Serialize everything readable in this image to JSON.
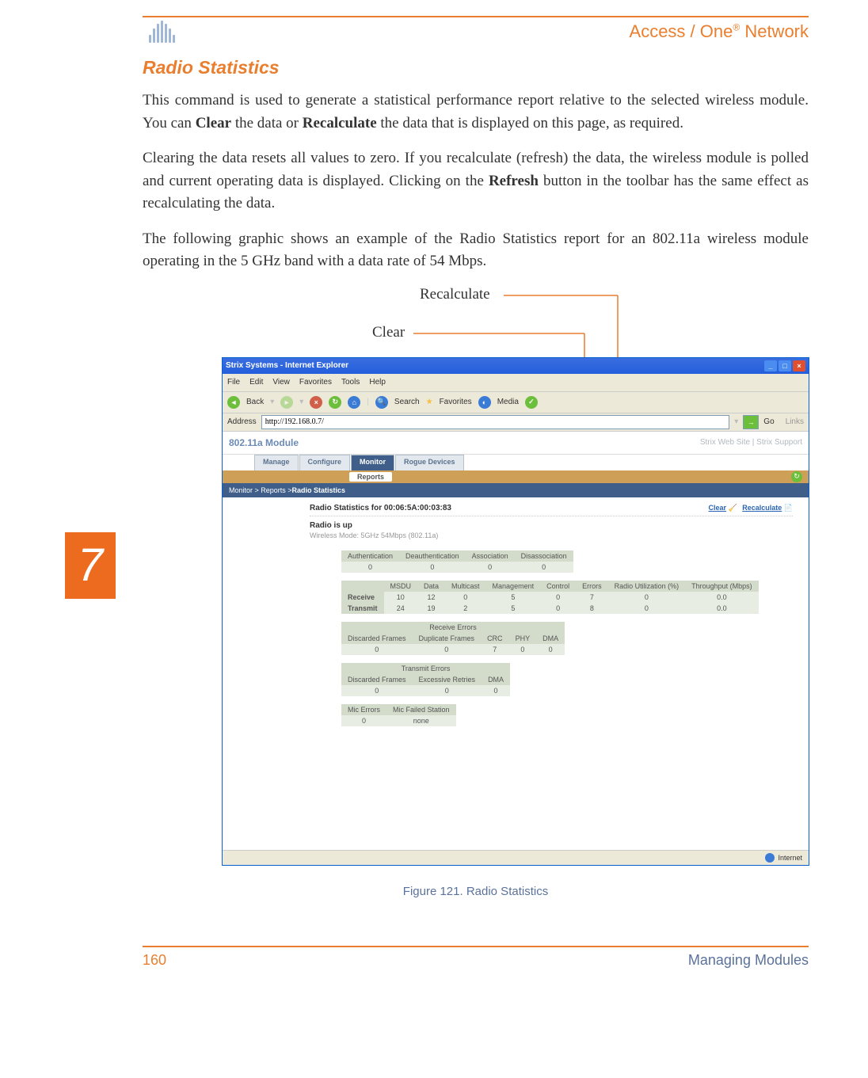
{
  "header": {
    "brand_html": "Access / One® Network"
  },
  "title": "Radio Statistics",
  "chapter_number": "7",
  "paragraphs": {
    "p1_pre": "This command is used to generate a statistical performance report relative to the selected wireless module. You can ",
    "p1_b1": "Clear",
    "p1_mid": " the data or ",
    "p1_b2": "Recalculate",
    "p1_post": " the data that is displayed on this page, as required.",
    "p2_pre": "Clearing the data resets all values to zero. If you recalculate (refresh) the data, the wireless module is polled and current operating data is displayed. Clicking on the ",
    "p2_b1": "Refresh",
    "p2_post": " button in the toolbar has the same effect as recalculating the data.",
    "p3": "The following graphic shows an example of the Radio Statistics report for an 802.11a wireless module operating in the 5 GHz band with a data rate of 54 Mbps."
  },
  "callouts": {
    "recalculate": "Recalculate",
    "clear": "Clear"
  },
  "screenshot": {
    "window_title": "Strix Systems - Internet Explorer",
    "menus": [
      "File",
      "Edit",
      "View",
      "Favorites",
      "Tools",
      "Help"
    ],
    "toolbar": {
      "back": "Back",
      "search": "Search",
      "favorites": "Favorites",
      "media": "Media"
    },
    "address_label": "Address",
    "address_value": "http://192.168.0.7/",
    "go": "Go",
    "links": "Links",
    "module_name": "802.11a Module",
    "site_links": "Strix Web Site  |  Strix Support",
    "tabs": [
      "Manage",
      "Configure",
      "Monitor",
      "Rogue Devices"
    ],
    "subtab": "Reports",
    "breadcrumb_pre": "Monitor > Reports > ",
    "breadcrumb_cur": "Radio Statistics",
    "stats_title": "Radio Statistics for 00:06:5A:00:03:83",
    "actions": {
      "clear": "Clear",
      "recalculate": "Recalculate"
    },
    "radio_status": "Radio is  up",
    "wireless_mode": "Wireless Mode: 5GHz 54Mbps (802.11a)",
    "table1": {
      "headers": [
        "Authentication",
        "Deauthentication",
        "Association",
        "Disassociation"
      ],
      "row": [
        "0",
        "0",
        "0",
        "0"
      ]
    },
    "table2": {
      "headers": [
        "",
        "MSDU",
        "Data",
        "Multicast",
        "Management",
        "Control",
        "Errors",
        "Radio Utilization (%)",
        "Throughput (Mbps)"
      ],
      "rows": [
        [
          "Receive",
          "10",
          "12",
          "0",
          "5",
          "0",
          "7",
          "0",
          "0.0"
        ],
        [
          "Transmit",
          "24",
          "19",
          "2",
          "5",
          "0",
          "8",
          "0",
          "0.0"
        ]
      ]
    },
    "rx_err": {
      "title": "Receive Errors",
      "headers": [
        "Discarded Frames",
        "Duplicate Frames",
        "CRC",
        "PHY",
        "DMA"
      ],
      "row": [
        "0",
        "0",
        "7",
        "0",
        "0"
      ]
    },
    "tx_err": {
      "title": "Transmit Errors",
      "headers": [
        "Discarded Frames",
        "Excessive Retries",
        "DMA"
      ],
      "row": [
        "0",
        "0",
        "0"
      ]
    },
    "mic": {
      "headers": [
        "Mic Errors",
        "Mic Failed Station"
      ],
      "row": [
        "0",
        "none"
      ]
    },
    "status_text": "Internet"
  },
  "figure_caption": "Figure 121. Radio Statistics",
  "footer": {
    "page": "160",
    "section": "Managing Modules"
  }
}
